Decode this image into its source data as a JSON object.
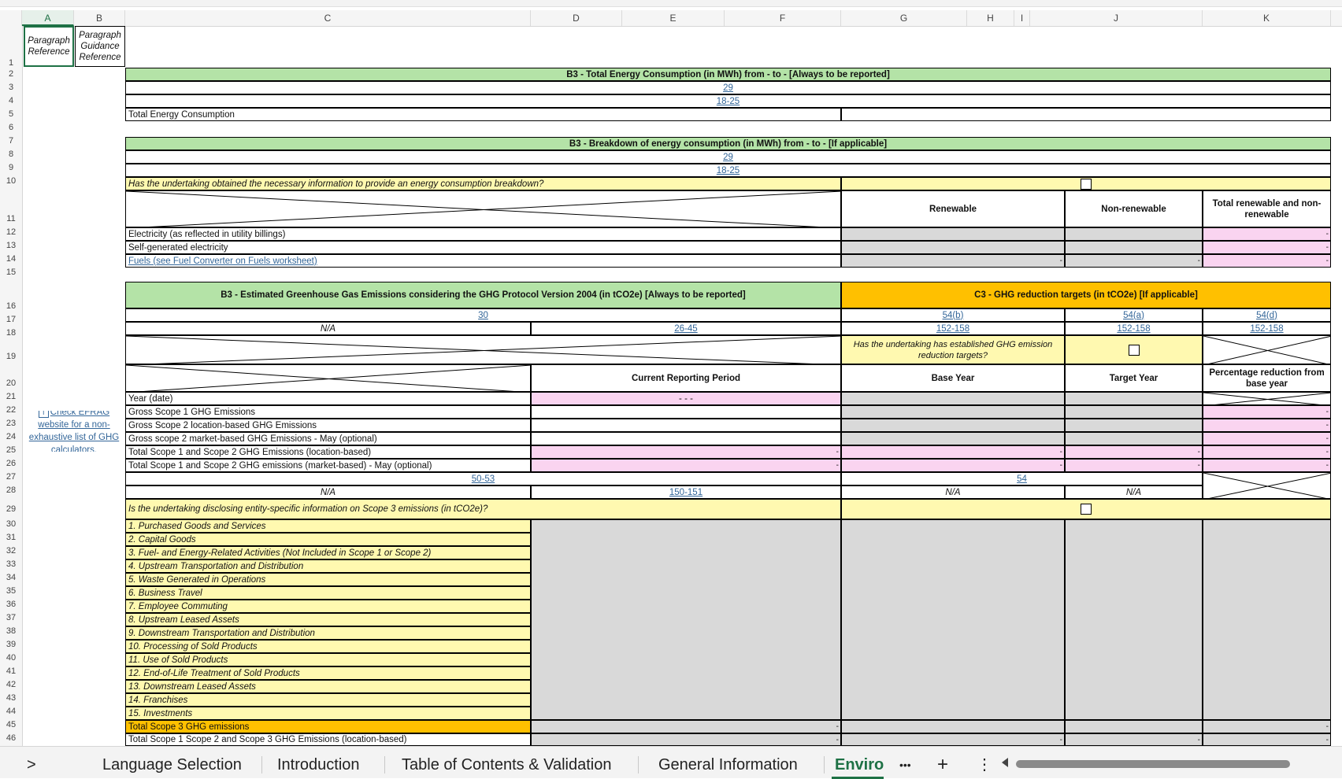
{
  "columns": [
    "A",
    "B",
    "C",
    "D",
    "E",
    "F",
    "G",
    "H",
    "I",
    "J",
    "K"
  ],
  "rows": [
    "1",
    "2",
    "3",
    "4",
    "5",
    "6",
    "7",
    "8",
    "9",
    "10",
    "11",
    "12",
    "13",
    "14",
    "15",
    "16",
    "17",
    "18",
    "19",
    "20",
    "21",
    "22",
    "23",
    "24",
    "25",
    "26",
    "27",
    "28",
    "29",
    "30",
    "31",
    "32",
    "33",
    "34",
    "35",
    "36",
    "37",
    "38",
    "39",
    "40",
    "41",
    "42",
    "43",
    "44",
    "45",
    "46"
  ],
  "header": {
    "para_ref": "Paragraph Reference",
    "para_guidance": "Paragraph Guidance Reference"
  },
  "energy": {
    "title": "B3 - Total Energy Consumption (in MWh) from - to - [Always to be reported]",
    "ref1": "29",
    "ref2": "18-25",
    "total_label": "Total Energy Consumption"
  },
  "breakdown": {
    "title": "B3 - Breakdown of energy consumption (in MWh) from - to - [If applicable]",
    "ref1": "29",
    "ref2": "18-25",
    "question": "Has the undertaking obtained the necessary information to provide an energy consumption breakdown?",
    "col_renewable": "Renewable",
    "col_nonrenewable": "Non-renewable",
    "col_total": "Total renewable and non-renewable",
    "items": [
      "Electricity (as reflected in utility billings)",
      "Self-generated electricity",
      "Fuels (see Fuel Converter on Fuels worksheet)"
    ]
  },
  "ghg": {
    "title": "B3 - Estimated Greenhouse Gas Emissions considering the GHG Protocol Version 2004 (in tCO2e) [Always to be reported]",
    "ref30": "30",
    "na": "N/A",
    "ref2645": "26-45",
    "current_period": "Current Reporting Period",
    "year_label": "Year (date)",
    "year_value": "- - -",
    "items": [
      "Gross Scope 1 GHG Emissions",
      "Gross Scope 2 location-based GHG Emissions",
      "Gross scope 2 market-based GHG Emissions - May (optional)",
      "Total Scope 1 and Scope 2 GHG Emissions (location-based)",
      "Total Scope 1 and Scope 2 GHG emissions  (market-based) - May (optional)"
    ],
    "ref5053": "50-53",
    "ref150151": "150-151",
    "scope3_question": "Is the undertaking disclosing entity-specific information on Scope 3 emissions (in tCO2e)?",
    "scope3_items": [
      "1. Purchased Goods and Services",
      "2. Capital Goods",
      "3. Fuel- and Energy-Related Activities (Not Included in Scope 1 or Scope 2)",
      "4. Upstream Transportation and Distribution",
      "5. Waste Generated in Operations",
      "6. Business Travel",
      "7. Employee Commuting",
      "8. Upstream Leased Assets",
      "9. Downstream Transportation and Distribution",
      "10. Processing of Sold Products",
      "11. Use of Sold Products",
      "12. End-of-Life Treatment of Sold Products",
      "13. Downstream Leased Assets",
      "14. Franchises",
      "15. Investments"
    ],
    "total_scope3": "Total Scope 3 GHG emissions",
    "total_all": "Total Scope 1 Scope 2 and Scope 3 GHG Emissions (location-based)"
  },
  "targets": {
    "title": "C3 - GHG reduction targets (in tCO2e) [If applicable]",
    "g_ref1": "54(b)",
    "g_ref2": "152-158",
    "j_ref1": "54(a)",
    "j_ref2": "152-158",
    "k_ref1": "54(d)",
    "k_ref2": "152-158",
    "question": "Has the undertaking has established GHG emission reduction targets?",
    "base_year": "Base Year",
    "target_year": "Target Year",
    "pct": "Percentage reduction from base year",
    "ref54": "54",
    "na": "N/A"
  },
  "efrag_note": "Check EFRAG website for a non-exhaustive list of GHG calculators.",
  "dash": "-",
  "sheet_tabs": [
    "Language Selection",
    "Introduction",
    "Table of Contents & Validation",
    "General Information",
    "Enviro"
  ],
  "tab_controls": {
    "prev": ">",
    "more": "•••",
    "add": "+",
    "options": "⋮"
  },
  "colors": {
    "green_header": "#b4e3a7",
    "yellow": "#fff9b0",
    "orange": "#ffc000",
    "pink": "#fad4f0",
    "grey": "#d9d9d9",
    "excel_green": "#1e7145"
  }
}
